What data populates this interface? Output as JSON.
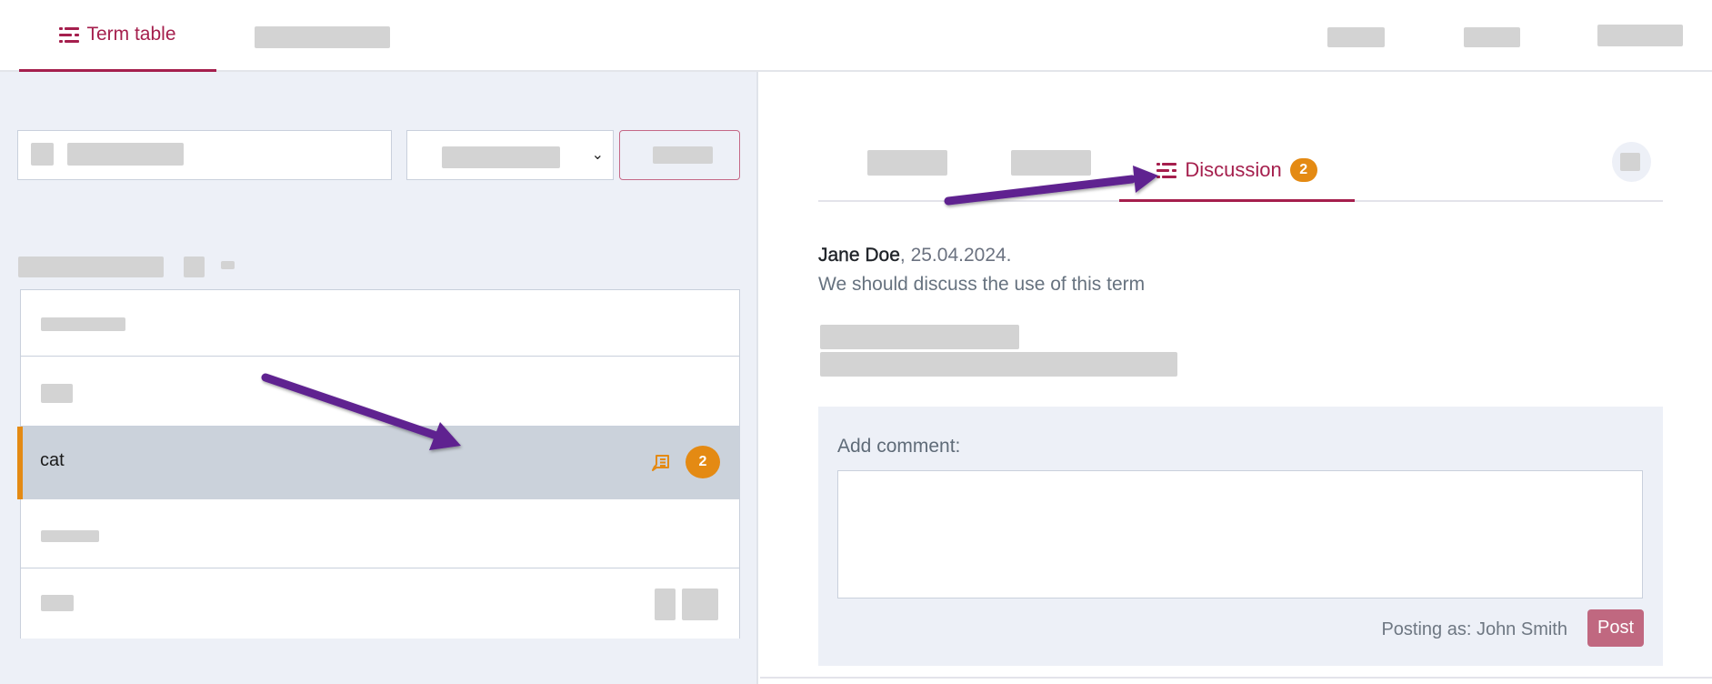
{
  "header": {
    "tabs": [
      {
        "label": "Term table",
        "icon": "list-icon",
        "active": true
      },
      {
        "label": "",
        "redacted": true
      }
    ],
    "right_items": [
      {
        "label": "",
        "redacted": true
      },
      {
        "label": "",
        "redacted": true
      },
      {
        "label": "",
        "redacted": true
      }
    ]
  },
  "left": {
    "search": {
      "placeholder": "",
      "redacted": true
    },
    "select": {
      "value": "",
      "redacted": true
    },
    "filter_button": {
      "label": "",
      "redacted": true
    },
    "table": {
      "rows": [
        {
          "term": "",
          "redacted": true
        },
        {
          "term": "",
          "redacted": true
        },
        {
          "term": "cat",
          "selected": true,
          "comment_count": "2",
          "icon": "comment-icon"
        },
        {
          "term": "",
          "redacted": true
        },
        {
          "term": "",
          "redacted": true
        }
      ]
    }
  },
  "right": {
    "tabs": [
      {
        "label": "",
        "redacted": true
      },
      {
        "label": "",
        "redacted": true
      },
      {
        "label": "Discussion",
        "icon": "list-icon",
        "badge": "2",
        "active": true
      }
    ],
    "comments": [
      {
        "author": "Jane Doe",
        "date": ", 25.04.2024.",
        "text": "We should discuss the use of this term"
      },
      {
        "author": "",
        "redacted": true
      }
    ],
    "add_comment": {
      "label": "Add comment:",
      "textarea_value": "",
      "posting_as": "Posting as: John Smith",
      "post_label": "Post"
    }
  },
  "colors": {
    "accent": "#a51f4d",
    "badge": "#e48a13",
    "selected_row": "#cbd2db",
    "panel_bg": "#edf0f7",
    "post_button": "#c06880",
    "annotation_arrow": "#5e2390"
  }
}
